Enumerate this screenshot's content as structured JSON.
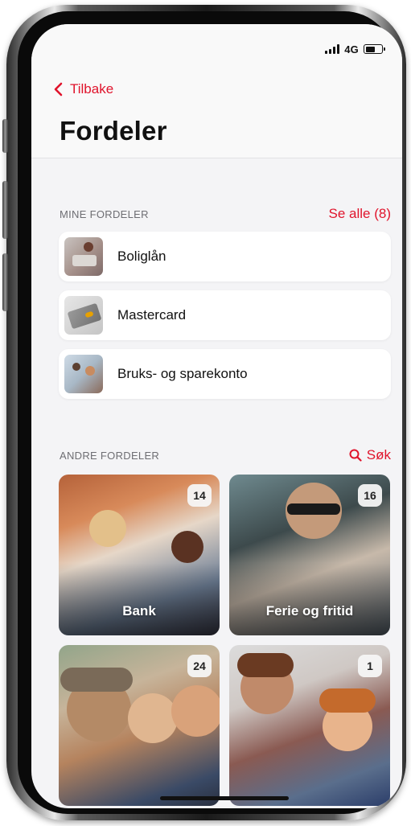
{
  "status_bar": {
    "network": "4G",
    "battery_level": 0.6
  },
  "nav": {
    "back_label": "Tilbake",
    "title": "Fordeler"
  },
  "mine_fordeler": {
    "header": "MINE FORDELER",
    "see_all": "Se alle (8)",
    "items": [
      {
        "label": "Boliglån",
        "thumb": "home-photo"
      },
      {
        "label": "Mastercard",
        "thumb": "card-photo"
      },
      {
        "label": "Bruks- og sparekonto",
        "thumb": "family-photo"
      }
    ]
  },
  "andre_fordeler": {
    "header": "ANDRE FORDELER",
    "search": "Søk",
    "tiles": [
      {
        "label": "Bank",
        "count": "14"
      },
      {
        "label": "Ferie og fritid",
        "count": "16"
      },
      {
        "label": "",
        "count": "24"
      },
      {
        "label": "",
        "count": "1"
      }
    ]
  },
  "colors": {
    "accent": "#e0142c",
    "background": "#f4f4f6"
  }
}
